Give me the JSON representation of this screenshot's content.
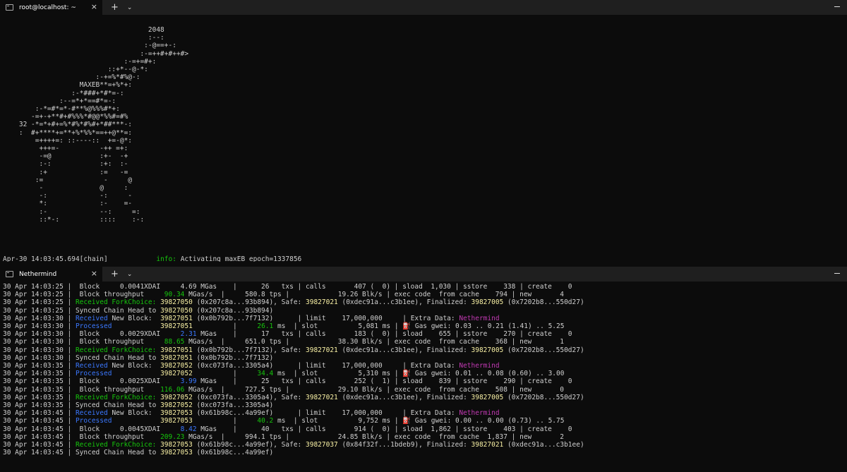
{
  "top_tab": {
    "title": "root@localhost: ~",
    "close": "×",
    "add": "+",
    "dropdown": "⌄"
  },
  "window": {
    "minimize": "—"
  },
  "ascii_art": [
    "                                    2048",
    "                                    :--:",
    "                                   :-@==+-:",
    "                                  :-=++#+#++#>",
    "                              :-=+=#+:",
    "                          ::+*--@-*:",
    "                       :-+=%*#%@-:",
    "                   MAXEB**=+%*+:",
    "                 :-*###+*#*=-:",
    "              :--=*+*==#*=-:",
    "        :-*=#*=*-#**%@%%%#*+:",
    "       -=+-+**#+#%%%*#@@*%%#=#%",
    "    32 -*=*+#+=%*#%*#%#+*##***-:",
    "    :  #+****+=**+%*%%*==++@**=:",
    "        =++++=: ::----::  +=-@*:",
    "         +++=-          -++ =+:",
    "         -=@            :+-  -+",
    "         :-:            :+:  :-",
    "         :+             :=   -=",
    "        :=               -     @",
    "         -              @     :",
    "         -:             -:     -",
    "         *:             :-    =-",
    "         :-             --:     =:",
    "         ::*-:          ::::    :-:"
  ],
  "chain_log": {
    "time": "Apr-30 14:03:45.694[chain]",
    "level": "info:",
    "message": " Activating maxEB epoch=1337856"
  },
  "bottom_tab": {
    "title": "Nethermind",
    "close": "×",
    "add": "+",
    "dropdown": "⌄"
  },
  "log_lines": [
    [
      {
        "t": "30 Apr 14:03:25 |  Block     0.0041XDAI     4.69 MGas    |      26   txs | calls       407 (  0) | sload  1,030 | sstore    338 | create    0"
      }
    ],
    [
      {
        "t": "30 Apr 14:03:25 |  Block throughput     "
      },
      {
        "t": "90.34",
        "c": "g"
      },
      {
        "t": " MGas/s  |     580.8 tps |            19.26 Blk/s | exec code  from cache    794 | new       4"
      }
    ],
    [
      {
        "t": "30 Apr 14:03:25 | "
      },
      {
        "t": "Received ForkChoice:",
        "c": "g"
      },
      {
        "t": " "
      },
      {
        "t": "39827050",
        "c": "y"
      },
      {
        "t": " (0x207c8a...93b894), Safe: "
      },
      {
        "t": "39827021",
        "c": "y"
      },
      {
        "t": " (0xdec91a...c3b1ee), Finalized: "
      },
      {
        "t": "39827005",
        "c": "y"
      },
      {
        "t": " (0x7202b8...550d27)"
      }
    ],
    [
      {
        "t": "30 Apr 14:03:25 | Synced Chain Head to "
      },
      {
        "t": "39827050",
        "c": "y"
      },
      {
        "t": " (0x207c8a...93b894)"
      }
    ],
    [
      {
        "t": "30 Apr 14:03:30 | "
      },
      {
        "t": "Received",
        "c": "b"
      },
      {
        "t": " New Block:  "
      },
      {
        "t": "39827051",
        "c": "y"
      },
      {
        "t": " (0x0b792b...7f7132)      | limit    17,000,000     | Extra Data: "
      },
      {
        "t": "Nethermind",
        "c": "m"
      }
    ],
    [
      {
        "t": "30 Apr 14:03:30 | "
      },
      {
        "t": "Processed",
        "c": "b"
      },
      {
        "t": "            "
      },
      {
        "t": "39827051",
        "c": "y"
      },
      {
        "t": "          |     "
      },
      {
        "t": "26.1",
        "c": "g"
      },
      {
        "t": " ms  | slot          5,081 ms | "
      },
      {
        "t": "⛽",
        "c": "fuel"
      },
      {
        "t": " Gas gwei: 0.03 .. 0.21 (1.41) .. 5.25"
      }
    ],
    [
      {
        "t": "30 Apr 14:03:30 |  Block     0.0029XDAI     "
      },
      {
        "t": "2.31",
        "c": "b"
      },
      {
        "t": " MGas    |      17   txs | calls       183 (  0) | sload    655 | sstore    270 | create    0"
      }
    ],
    [
      {
        "t": "30 Apr 14:03:30 |  Block throughput     "
      },
      {
        "t": "88.65",
        "c": "g"
      },
      {
        "t": " MGas/s  |     651.0 tps |            38.30 Blk/s | exec code  from cache    368 | new       1"
      }
    ],
    [
      {
        "t": "30 Apr 14:03:30 | "
      },
      {
        "t": "Received ForkChoice:",
        "c": "g"
      },
      {
        "t": " "
      },
      {
        "t": "39827051",
        "c": "y"
      },
      {
        "t": " (0x0b792b...7f7132), Safe: "
      },
      {
        "t": "39827021",
        "c": "y"
      },
      {
        "t": " (0xdec91a...c3b1ee), Finalized: "
      },
      {
        "t": "39827005",
        "c": "y"
      },
      {
        "t": " (0x7202b8...550d27)"
      }
    ],
    [
      {
        "t": "30 Apr 14:03:30 | Synced Chain Head to "
      },
      {
        "t": "39827051",
        "c": "y"
      },
      {
        "t": " (0x0b792b...7f7132)"
      }
    ],
    [
      {
        "t": "30 Apr 14:03:35 | "
      },
      {
        "t": "Received",
        "c": "b"
      },
      {
        "t": " New Block:  "
      },
      {
        "t": "39827052",
        "c": "y"
      },
      {
        "t": " (0xc073fa...3305a4)      | limit    17,000,000     | Extra Data: "
      },
      {
        "t": "Nethermind",
        "c": "m"
      }
    ],
    [
      {
        "t": "30 Apr 14:03:35 | "
      },
      {
        "t": "Processed",
        "c": "b"
      },
      {
        "t": "            "
      },
      {
        "t": "39827052",
        "c": "y"
      },
      {
        "t": "          |     "
      },
      {
        "t": "34.4",
        "c": "g"
      },
      {
        "t": " ms  | slot          5,310 ms | "
      },
      {
        "t": "⛽",
        "c": "fuel"
      },
      {
        "t": " Gas gwei: 0.01 .. 0.08 (0.60) .. 3.00"
      }
    ],
    [
      {
        "t": "30 Apr 14:03:35 |  Block     0.0025XDAI     "
      },
      {
        "t": "3.99",
        "c": "b"
      },
      {
        "t": " MGas    |      25   txs | calls       252 (  1) | sload    839 | sstore    290 | create    0"
      }
    ],
    [
      {
        "t": "30 Apr 14:03:35 |  Block throughput    "
      },
      {
        "t": "116.06",
        "c": "g"
      },
      {
        "t": " MGas/s  |     727.5 tps |            29.10 Blk/s | exec code  from cache    508 | new       0"
      }
    ],
    [
      {
        "t": "30 Apr 14:03:35 | "
      },
      {
        "t": "Received ForkChoice:",
        "c": "g"
      },
      {
        "t": " "
      },
      {
        "t": "39827052",
        "c": "y"
      },
      {
        "t": " (0xc073fa...3305a4), Safe: "
      },
      {
        "t": "39827021",
        "c": "y"
      },
      {
        "t": " (0xdec91a...c3b1ee), Finalized: "
      },
      {
        "t": "39827005",
        "c": "y"
      },
      {
        "t": " (0x7202b8...550d27)"
      }
    ],
    [
      {
        "t": "30 Apr 14:03:35 | Synced Chain Head to "
      },
      {
        "t": "39827052",
        "c": "y"
      },
      {
        "t": " (0xc073fa...3305a4)"
      }
    ],
    [
      {
        "t": "30 Apr 14:03:45 | "
      },
      {
        "t": "Received",
        "c": "b"
      },
      {
        "t": " New Block:  "
      },
      {
        "t": "39827053",
        "c": "y"
      },
      {
        "t": " (0x61b98c...4a99ef)      | limit    17,000,000     | Extra Data: "
      },
      {
        "t": "Nethermind",
        "c": "m"
      }
    ],
    [
      {
        "t": "30 Apr 14:03:45 | "
      },
      {
        "t": "Processed",
        "c": "b"
      },
      {
        "t": "            "
      },
      {
        "t": "39827053",
        "c": "y"
      },
      {
        "t": "          |     "
      },
      {
        "t": "40.2",
        "c": "g"
      },
      {
        "t": " ms  | slot          9,752 ms | "
      },
      {
        "t": "⛽",
        "c": "fuel"
      },
      {
        "t": " Gas gwei: 0.00 .. 0.00 (0.73) .. 5.75"
      }
    ],
    [
      {
        "t": "30 Apr 14:03:45 |  Block     0.0045XDAI     "
      },
      {
        "t": "8.42",
        "c": "b"
      },
      {
        "t": " MGas    |      40   txs | calls       914 (  0) | sload  1,862 | sstore    403 | create    0"
      }
    ],
    [
      {
        "t": "30 Apr 14:03:45 |  Block throughput    "
      },
      {
        "t": "209.23",
        "c": "g"
      },
      {
        "t": " MGas/s  |     994.1 tps |            24.85 Blk/s | exec code  from cache  1,837 | new       2"
      }
    ],
    [
      {
        "t": "30 Apr 14:03:45 | "
      },
      {
        "t": "Received ForkChoice:",
        "c": "g"
      },
      {
        "t": " "
      },
      {
        "t": "39827053",
        "c": "y"
      },
      {
        "t": " (0x61b98c...4a99ef), Safe: "
      },
      {
        "t": "39827037",
        "c": "y"
      },
      {
        "t": " (0x84f32f...1bdeb9), Finalized: "
      },
      {
        "t": "39827021",
        "c": "y"
      },
      {
        "t": " (0xdec91a...c3b1ee)"
      }
    ],
    [
      {
        "t": "30 Apr 14:03:45 | Synced Chain Head to "
      },
      {
        "t": "39827053",
        "c": "y"
      },
      {
        "t": " (0x61b98c...4a99ef)"
      }
    ]
  ]
}
